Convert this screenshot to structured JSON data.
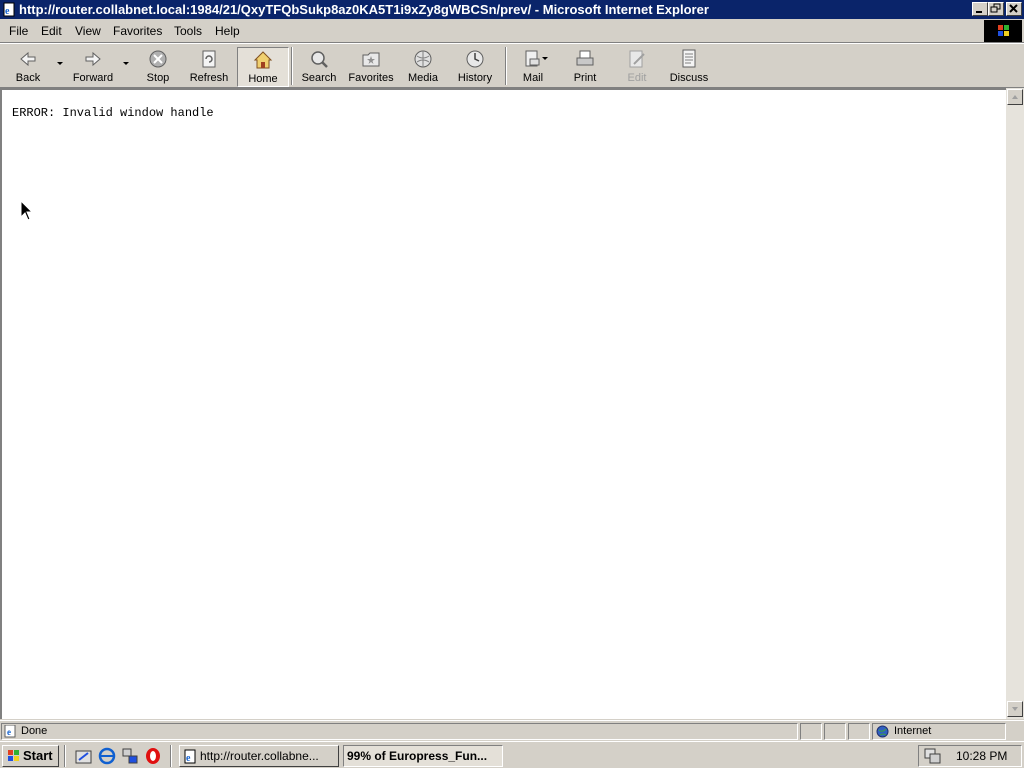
{
  "window": {
    "title": "http://router.collabnet.local:1984/21/QxyTFQbSukp8az0KA5T1i9xZy8gWBCSn/prev/ - Microsoft Internet Explorer",
    "icon": "ie-page-icon"
  },
  "menubar": {
    "items": [
      "File",
      "Edit",
      "View",
      "Favorites",
      "Tools",
      "Help"
    ]
  },
  "toolbar": {
    "back": "Back",
    "forward": "Forward",
    "stop": "Stop",
    "refresh": "Refresh",
    "home": "Home",
    "search": "Search",
    "favorites": "Favorites",
    "media": "Media",
    "history": "History",
    "mail": "Mail",
    "print": "Print",
    "edit": "Edit",
    "discuss": "Discuss"
  },
  "content": {
    "error_text": "ERROR: Invalid window handle"
  },
  "statusbar": {
    "status": "Done",
    "zone": "Internet"
  },
  "taskbar": {
    "start_label": "Start",
    "tasks": [
      "http://router.collabne...",
      "99% of Europress_Fun..."
    ],
    "clock": "10:28 PM"
  },
  "colors": {
    "title_bar": "#0a246a",
    "face": "#d4d0c8",
    "content_bg": "#ffffff"
  }
}
